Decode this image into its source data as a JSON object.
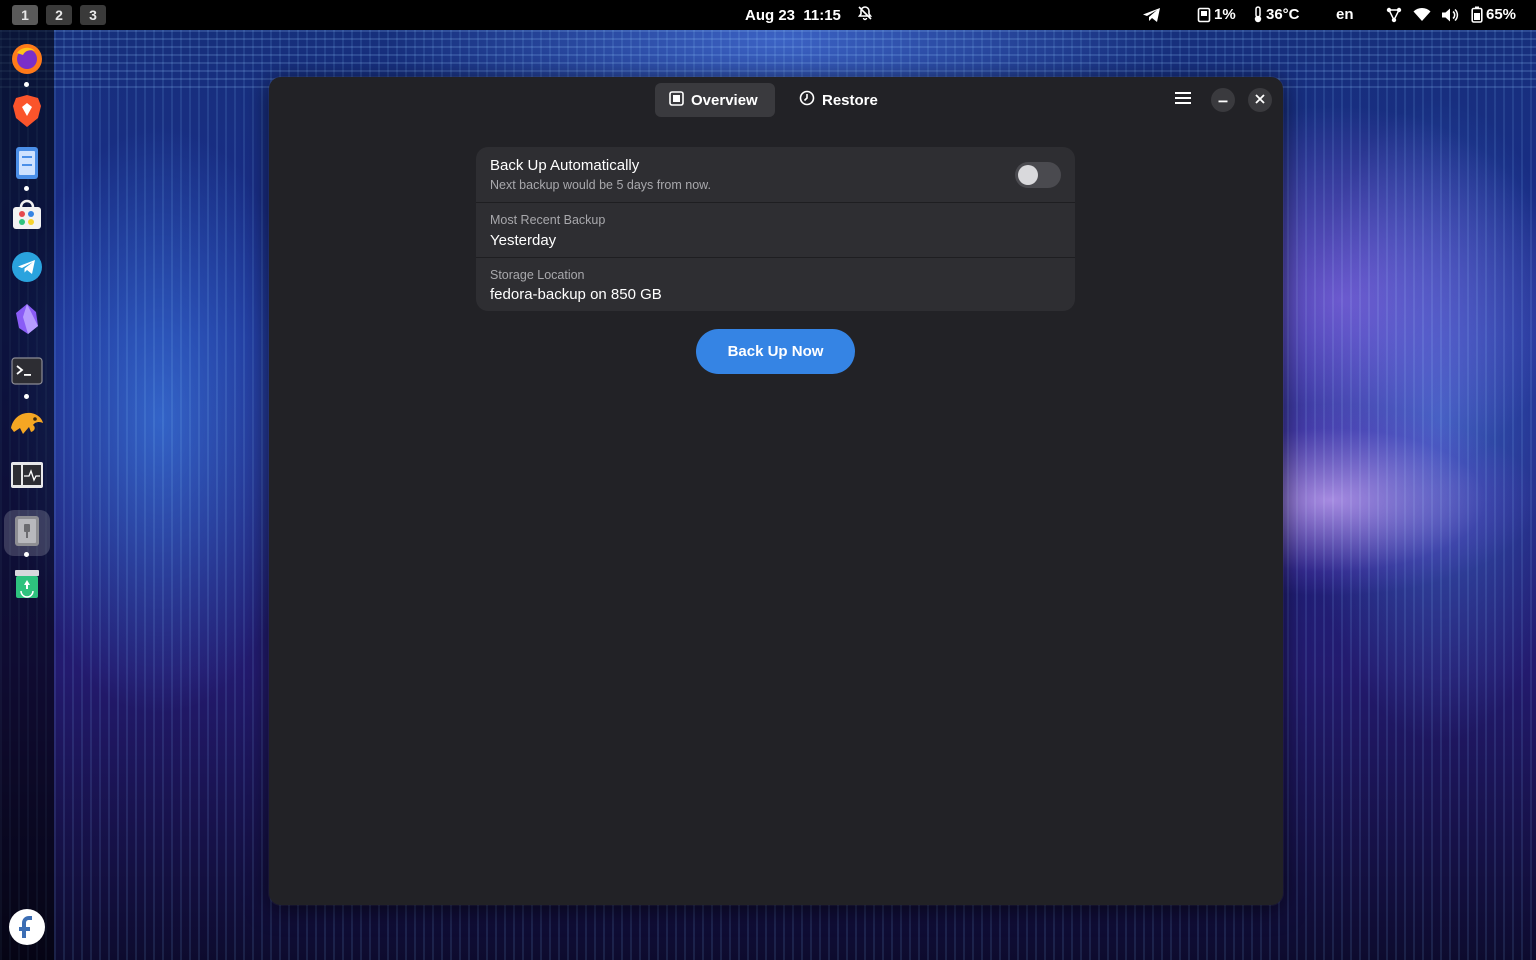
{
  "topbar": {
    "workspaces": [
      "1",
      "2",
      "3"
    ],
    "date": "Aug 23",
    "time": "11:15",
    "notification_icon": "bell-off-icon",
    "telegram_icon": "telegram-icon",
    "storage": "1%",
    "temperature": "36°C",
    "language": "en",
    "battery": "65%",
    "icons": [
      "storage-icon",
      "thermometer-icon",
      "network-icon",
      "wifi-icon",
      "volume-icon",
      "battery-icon"
    ]
  },
  "dock": {
    "apps": [
      {
        "name": "firefox",
        "icon": "firefox-icon",
        "running": true
      },
      {
        "name": "brave",
        "icon": "brave-icon",
        "running": false
      },
      {
        "name": "file-manager",
        "icon": "files-icon",
        "running": true
      },
      {
        "name": "software",
        "icon": "software-icon",
        "running": false
      },
      {
        "name": "telegram",
        "icon": "telegram-icon",
        "running": false
      },
      {
        "name": "obsidian",
        "icon": "obsidian-icon",
        "running": false
      },
      {
        "name": "terminal",
        "icon": "terminal-icon",
        "running": true
      },
      {
        "name": "dbeaver",
        "icon": "dbeaver-icon",
        "running": false
      },
      {
        "name": "system-monitor",
        "icon": "system-monitor-icon",
        "running": false
      },
      {
        "name": "backups",
        "icon": "backup-icon",
        "running": true,
        "focused": true
      },
      {
        "name": "trash",
        "icon": "trash-icon",
        "running": false
      }
    ],
    "os_logo": "fedora-logo-icon"
  },
  "window": {
    "tabs": [
      {
        "label": "Overview",
        "icon": "overview-icon",
        "selected": true
      },
      {
        "label": "Restore",
        "icon": "clock-icon",
        "selected": false
      }
    ],
    "controls": [
      "hamburger-menu-icon",
      "minimize-icon",
      "close-icon"
    ],
    "auto_backup": {
      "title": "Back Up Automatically",
      "subtitle": "Next backup would be 5 days from now.",
      "enabled": false
    },
    "recent_backup": {
      "label": "Most Recent Backup",
      "value": "Yesterday"
    },
    "storage_location": {
      "label": "Storage Location",
      "value": "fedora-backup on 850 GB"
    },
    "backup_now_label": "Back Up Now"
  },
  "colors": {
    "accent": "#3584e4",
    "window_bg": "#222226",
    "card_bg": "#2e2e32",
    "topbar_bg": "#000000"
  }
}
